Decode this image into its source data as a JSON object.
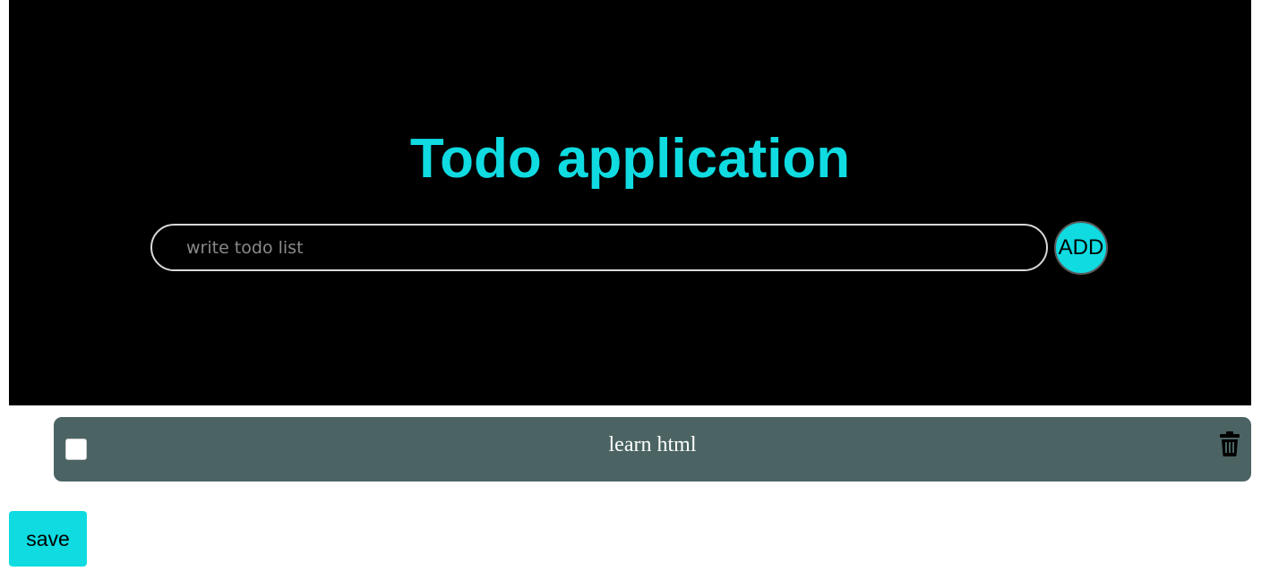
{
  "header": {
    "title": "Todo application",
    "input": {
      "placeholder": "write todo list",
      "value": ""
    },
    "add_label": "ADD"
  },
  "todos": [
    {
      "text": "learn html",
      "checked": false
    }
  ],
  "footer": {
    "save_label": "save"
  },
  "colors": {
    "accent": "#0fdbe1",
    "header_bg": "#000000",
    "item_bg": "#4b6463"
  },
  "icons": {
    "delete": "trash-icon"
  }
}
